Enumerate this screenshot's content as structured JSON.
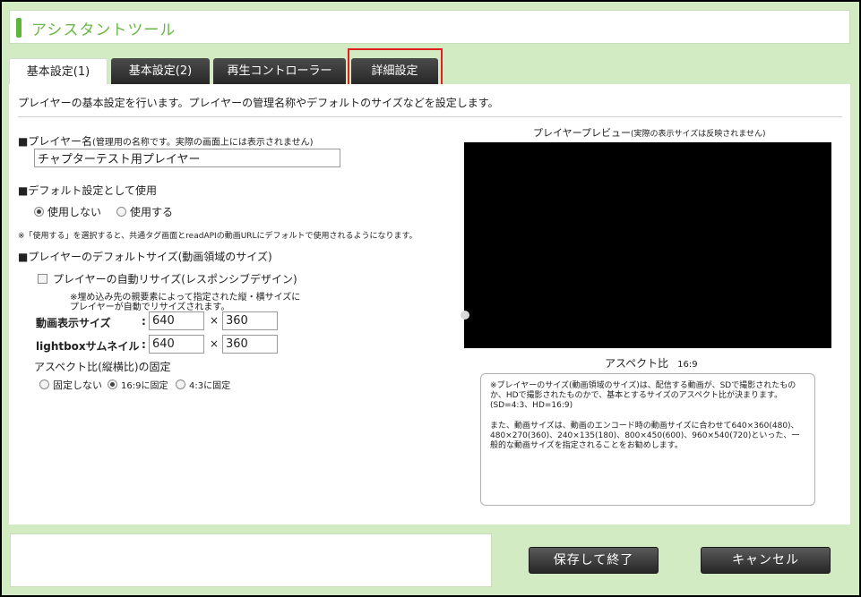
{
  "app": {
    "title": "アシスタントツール"
  },
  "tabs": [
    {
      "label": "基本設定(1)"
    },
    {
      "label": "基本設定(2)"
    },
    {
      "label": "再生コントローラー"
    },
    {
      "label": "詳細設定"
    }
  ],
  "description": "プレイヤーの基本設定を行います。プレイヤーの管理名称やデフォルトのサイズなどを設定します。",
  "player_name": {
    "heading": "■プレイヤー名",
    "heading_note": "(管理用の名称です。実際の画面上には表示されません)",
    "value": "チャプターテスト用プレイヤー"
  },
  "default_setting": {
    "heading": "■デフォルト設定として使用",
    "options": [
      "使用しない",
      "使用する"
    ],
    "selected": 0,
    "note": "※「使用する」を選択すると、共通タグ画面とreadAPIの動画URLにデフォルトで使用されるようになります。"
  },
  "default_size": {
    "heading": "■プレイヤーのデフォルトサイズ(動画領域のサイズ)",
    "auto_resize_label": "プレイヤーの自動リサイズ(レスポンシブデザイン)",
    "auto_resize_note_1": "※埋め込み先の親要素によって指定された縦・横サイズに",
    "auto_resize_note_2": "プレイヤーが自動でリサイズされます。",
    "video_size_label": "動画表示サイズ",
    "video_width": "640",
    "video_height": "360",
    "lightbox_label": "lightboxサムネイル",
    "lightbox_width": "640",
    "lightbox_height": "360",
    "colon": ":",
    "times": "×"
  },
  "aspect_lock": {
    "heading": "アスペクト比(縦横比)の固定",
    "options": [
      "固定しない",
      "16:9に固定",
      "4:3に固定"
    ],
    "selected": 1
  },
  "preview": {
    "title": "プレイヤープレビュー",
    "title_note": "(実際の表示サイズは反映されません)",
    "aspect_label": "アスペクト比",
    "aspect_value": "16:9"
  },
  "info": {
    "para1": "※プレイヤーのサイズ(動画領域のサイズ)は、配信する動画が、SDで撮影されたものか、HDで撮影されたものかで、基本とするサイズのアスペクト比が決まります。(SD=4:3、HD=16:9)",
    "para2": "また、動画サイズは、動画のエンコード時の動画サイズに合わせて640×360(480)、480×270(360)、240×135(180)、800×450(600)、960×540(720)といった、一般的な動画サイズを指定されることをお勧めします。"
  },
  "buttons": {
    "save": "保存して終了",
    "cancel": "キャンセル"
  }
}
